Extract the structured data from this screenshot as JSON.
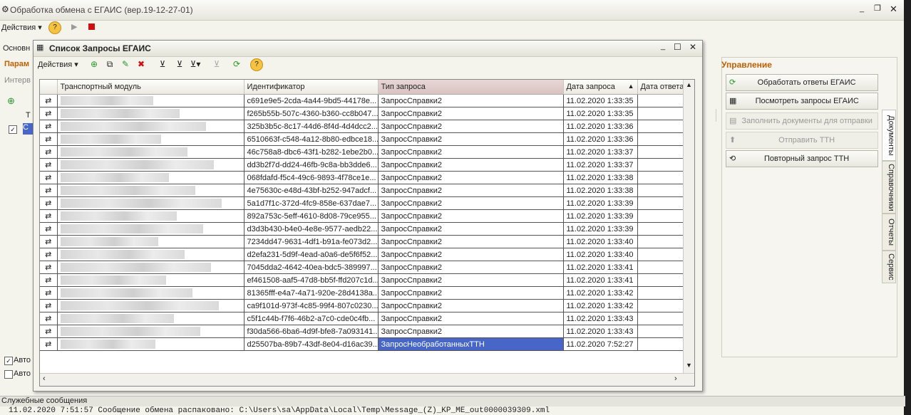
{
  "main": {
    "title": "Обработка обмена с ЕГАИС  (вер.19-12-27-01)",
    "actions_label": "Действия ▾",
    "left_tab_label": "Основн",
    "left_section_label": "Парам",
    "left_filter_label": "Интерв",
    "left_col_label": "Т",
    "left_row_label": "С",
    "auto_label_1": "Авто",
    "auto_label_2": "Авто"
  },
  "upravlenie": {
    "title": "Управление",
    "buttons": [
      {
        "label": "Обработать ответы ЕГАИС",
        "enabled": true
      },
      {
        "label": "Посмотреть запросы ЕГАИС",
        "enabled": true
      },
      {
        "label": "Заполнить документы для отправки",
        "enabled": false
      },
      {
        "label": "Отправить ТТН",
        "enabled": false
      },
      {
        "label": "Повторный запрос ТТН",
        "enabled": true
      }
    ],
    "side_tabs": [
      "Документы",
      "Справочники",
      "Отчеты",
      "Сервис"
    ]
  },
  "dialog": {
    "title": "Список Запросы ЕГАИС",
    "actions_label": "Действия ▾",
    "columns": [
      "Транспортный модуль",
      "Идентификатор",
      "Тип запроса",
      "Дата запроса",
      "Дата ответа"
    ],
    "rows": [
      {
        "id": "c691e9e5-2cda-4a44-9bd5-44178e...",
        "type": "ЗапросСправки2",
        "date": "11.02.2020 1:33:35"
      },
      {
        "id": "f265b55b-507c-4360-b360-cc8b047...",
        "type": "ЗапросСправки2",
        "date": "11.02.2020 1:33:35"
      },
      {
        "id": "325b3b5c-8c17-44d6-8f4d-4d4dcc2...",
        "type": "ЗапросСправки2",
        "date": "11.02.2020 1:33:36"
      },
      {
        "id": "6510663f-c548-4a12-8b80-edbce18...",
        "type": "ЗапросСправки2",
        "date": "11.02.2020 1:33:36"
      },
      {
        "id": "46c758a8-dbc6-43f1-b282-1ebe2b0...",
        "type": "ЗапросСправки2",
        "date": "11.02.2020 1:33:37"
      },
      {
        "id": "dd3b2f7d-dd24-46fb-9c8a-bb3dde6...",
        "type": "ЗапросСправки2",
        "date": "11.02.2020 1:33:37"
      },
      {
        "id": "068fdafd-f5c4-49c6-9893-4f78ce1e...",
        "type": "ЗапросСправки2",
        "date": "11.02.2020 1:33:38"
      },
      {
        "id": "4e75630c-e48d-43bf-b252-947adcf...",
        "type": "ЗапросСправки2",
        "date": "11.02.2020 1:33:38"
      },
      {
        "id": "5a1d7f1c-372d-4fc9-858e-637dae7...",
        "type": "ЗапросСправки2",
        "date": "11.02.2020 1:33:39"
      },
      {
        "id": "892a753c-5eff-4610-8d08-79ce955...",
        "type": "ЗапросСправки2",
        "date": "11.02.2020 1:33:39"
      },
      {
        "id": "d3d3b430-b4e0-4e8e-9577-aedb22...",
        "type": "ЗапросСправки2",
        "date": "11.02.2020 1:33:39"
      },
      {
        "id": "7234dd47-9631-4df1-b91a-fe073d2...",
        "type": "ЗапросСправки2",
        "date": "11.02.2020 1:33:40"
      },
      {
        "id": "d2efa231-5d9f-4ead-a0a6-de5f6f52...",
        "type": "ЗапросСправки2",
        "date": "11.02.2020 1:33:40"
      },
      {
        "id": "7045dda2-4642-40ea-bdc5-389997...",
        "type": "ЗапросСправки2",
        "date": "11.02.2020 1:33:41"
      },
      {
        "id": "ef461508-aaf5-47d8-bb5f-ffd207c1d...",
        "type": "ЗапросСправки2",
        "date": "11.02.2020 1:33:41"
      },
      {
        "id": "81365fff-e4a7-4a71-920e-28d4138a...",
        "type": "ЗапросСправки2",
        "date": "11.02.2020 1:33:42"
      },
      {
        "id": "ca9f101d-973f-4c85-99f4-807c0230...",
        "type": "ЗапросСправки2",
        "date": "11.02.2020 1:33:42"
      },
      {
        "id": "c5f1c44b-f7f6-46b2-a7c0-cde0c4fb...",
        "type": "ЗапросСправки2",
        "date": "11.02.2020 1:33:43"
      },
      {
        "id": "f30da566-6ba6-4d9f-bfe8-7a093141...",
        "type": "ЗапросСправки2",
        "date": "11.02.2020 1:33:43"
      },
      {
        "id": "d25507ba-89b7-43df-8e04-d16ac39...",
        "type": "ЗапросНеобработанныхТТН",
        "date": "11.02.2020 7:52:27",
        "selected": true
      }
    ]
  },
  "messages": {
    "title": "Служебные сообщения",
    "line": "11.02.2020 7:51:57 Сообщение обмена распаковано: C:\\Users\\sa\\AppData\\Local\\Temp\\Message_(Z)_KP_ME_out0000039309.xml"
  },
  "colors": {
    "selection": "#4766c8",
    "accent": "#c06000"
  }
}
